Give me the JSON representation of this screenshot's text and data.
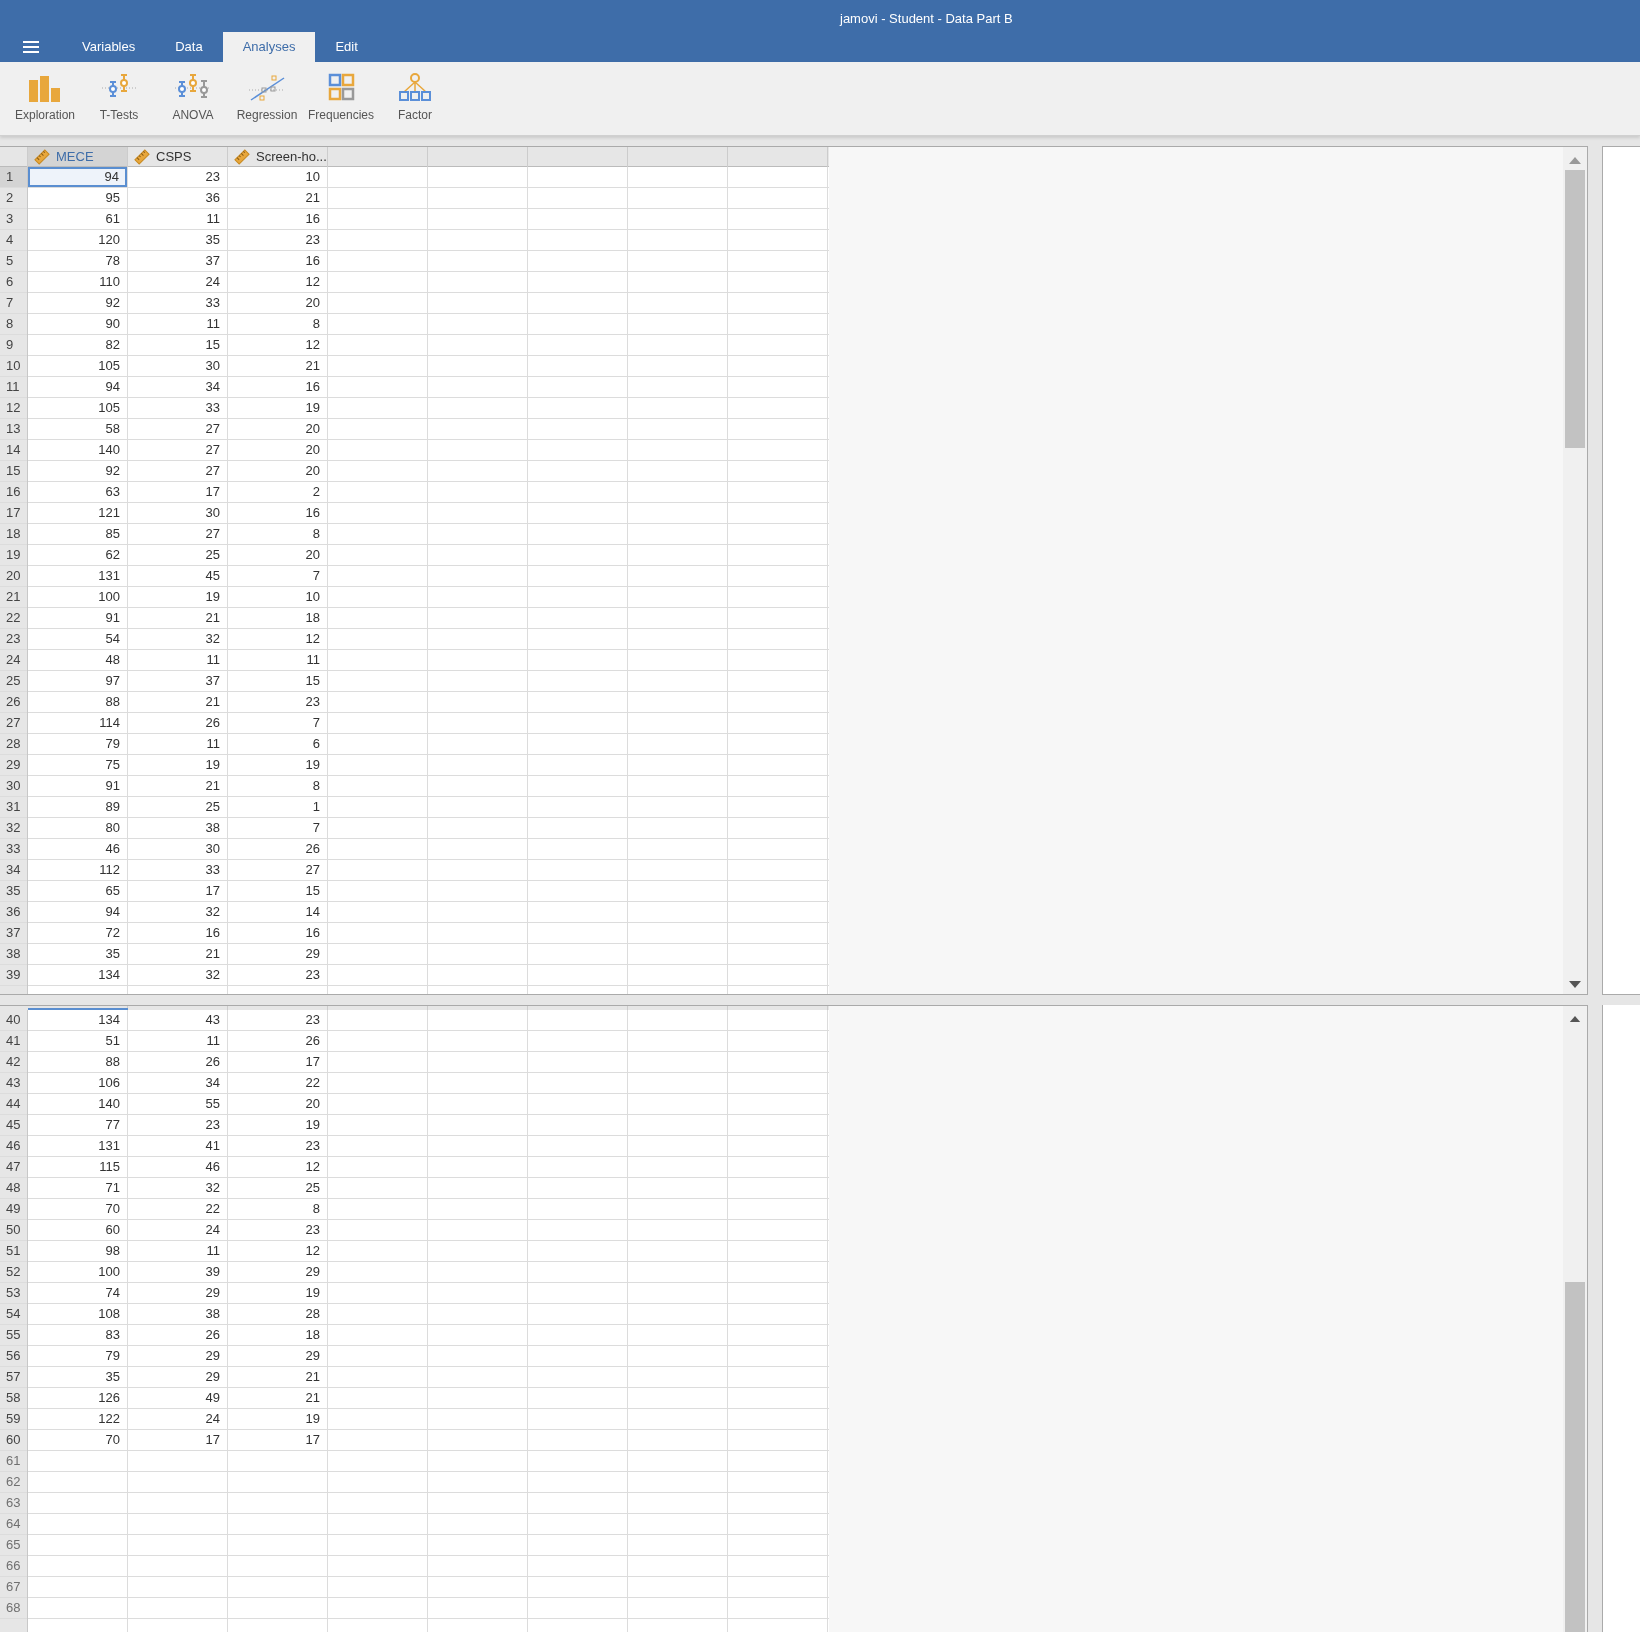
{
  "window": {
    "title": "jamovi - Student - Data Part B"
  },
  "menu_tabs": [
    {
      "label": "Variables",
      "selected": false
    },
    {
      "label": "Data",
      "selected": false
    },
    {
      "label": "Analyses",
      "selected": true
    },
    {
      "label": "Edit",
      "selected": false
    }
  ],
  "toolbar": [
    {
      "kind": "exploration",
      "label": "Exploration"
    },
    {
      "kind": "ttests",
      "label": "T-Tests"
    },
    {
      "kind": "anova",
      "label": "ANOVA"
    },
    {
      "kind": "regression",
      "label": "Regression"
    },
    {
      "kind": "frequencies",
      "label": "Frequencies"
    },
    {
      "kind": "factor",
      "label": "Factor"
    }
  ],
  "panes": [
    {
      "columns": [
        {
          "name": "MECE",
          "selected": true
        },
        {
          "name": "CSPS",
          "selected": false
        },
        {
          "name": "Screen-ho...",
          "selected": false
        }
      ],
      "rows": [
        {
          "number": "1",
          "selected": true,
          "cells": [
            "94",
            "23",
            "10"
          ]
        },
        {
          "number": "2",
          "selected": false,
          "cells": [
            "95",
            "36",
            "21"
          ]
        },
        {
          "number": "3",
          "selected": false,
          "cells": [
            "61",
            "11",
            "16"
          ]
        },
        {
          "number": "4",
          "selected": false,
          "cells": [
            "120",
            "35",
            "23"
          ]
        },
        {
          "number": "5",
          "selected": false,
          "cells": [
            "78",
            "37",
            "16"
          ]
        },
        {
          "number": "6",
          "selected": false,
          "cells": [
            "110",
            "24",
            "12"
          ]
        },
        {
          "number": "7",
          "selected": false,
          "cells": [
            "92",
            "33",
            "20"
          ]
        },
        {
          "number": "8",
          "selected": false,
          "cells": [
            "90",
            "11",
            "8"
          ]
        },
        {
          "number": "9",
          "selected": false,
          "cells": [
            "82",
            "15",
            "12"
          ]
        },
        {
          "number": "10",
          "selected": false,
          "cells": [
            "105",
            "30",
            "21"
          ]
        },
        {
          "number": "11",
          "selected": false,
          "cells": [
            "94",
            "34",
            "16"
          ]
        },
        {
          "number": "12",
          "selected": false,
          "cells": [
            "105",
            "33",
            "19"
          ]
        },
        {
          "number": "13",
          "selected": false,
          "cells": [
            "58",
            "27",
            "20"
          ]
        },
        {
          "number": "14",
          "selected": false,
          "cells": [
            "140",
            "27",
            "20"
          ]
        },
        {
          "number": "15",
          "selected": false,
          "cells": [
            "92",
            "27",
            "20"
          ]
        },
        {
          "number": "16",
          "selected": false,
          "cells": [
            "63",
            "17",
            "2"
          ]
        },
        {
          "number": "17",
          "selected": false,
          "cells": [
            "121",
            "30",
            "16"
          ]
        },
        {
          "number": "18",
          "selected": false,
          "cells": [
            "85",
            "27",
            "8"
          ]
        },
        {
          "number": "19",
          "selected": false,
          "cells": [
            "62",
            "25",
            "20"
          ]
        },
        {
          "number": "20",
          "selected": false,
          "cells": [
            "131",
            "45",
            "7"
          ]
        },
        {
          "number": "21",
          "selected": false,
          "cells": [
            "100",
            "19",
            "10"
          ]
        },
        {
          "number": "22",
          "selected": false,
          "cells": [
            "91",
            "21",
            "18"
          ]
        },
        {
          "number": "23",
          "selected": false,
          "cells": [
            "54",
            "32",
            "12"
          ]
        },
        {
          "number": "24",
          "selected": false,
          "cells": [
            "48",
            "11",
            "11"
          ]
        },
        {
          "number": "25",
          "selected": false,
          "cells": [
            "97",
            "37",
            "15"
          ]
        },
        {
          "number": "26",
          "selected": false,
          "cells": [
            "88",
            "21",
            "23"
          ]
        },
        {
          "number": "27",
          "selected": false,
          "cells": [
            "114",
            "26",
            "7"
          ]
        },
        {
          "number": "28",
          "selected": false,
          "cells": [
            "79",
            "11",
            "6"
          ]
        },
        {
          "number": "29",
          "selected": false,
          "cells": [
            "75",
            "19",
            "19"
          ]
        },
        {
          "number": "30",
          "selected": false,
          "cells": [
            "91",
            "21",
            "8"
          ]
        },
        {
          "number": "31",
          "selected": false,
          "cells": [
            "89",
            "25",
            "1"
          ]
        },
        {
          "number": "32",
          "selected": false,
          "cells": [
            "80",
            "38",
            "7"
          ]
        },
        {
          "number": "33",
          "selected": false,
          "cells": [
            "46",
            "30",
            "26"
          ]
        },
        {
          "number": "34",
          "selected": false,
          "cells": [
            "112",
            "33",
            "27"
          ]
        },
        {
          "number": "35",
          "selected": false,
          "cells": [
            "65",
            "17",
            "15"
          ]
        },
        {
          "number": "36",
          "selected": false,
          "cells": [
            "94",
            "32",
            "14"
          ]
        },
        {
          "number": "37",
          "selected": false,
          "cells": [
            "72",
            "16",
            "16"
          ]
        },
        {
          "number": "38",
          "selected": false,
          "cells": [
            "35",
            "21",
            "29"
          ]
        },
        {
          "number": "39",
          "selected": false,
          "cells": [
            "134",
            "32",
            "23"
          ]
        }
      ]
    },
    {
      "rows": [
        {
          "number": "40",
          "selected": false,
          "cells": [
            "134",
            "43",
            "23"
          ]
        },
        {
          "number": "41",
          "selected": false,
          "cells": [
            "51",
            "11",
            "26"
          ]
        },
        {
          "number": "42",
          "selected": false,
          "cells": [
            "88",
            "26",
            "17"
          ]
        },
        {
          "number": "43",
          "selected": false,
          "cells": [
            "106",
            "34",
            "22"
          ]
        },
        {
          "number": "44",
          "selected": false,
          "cells": [
            "140",
            "55",
            "20"
          ]
        },
        {
          "number": "45",
          "selected": false,
          "cells": [
            "77",
            "23",
            "19"
          ]
        },
        {
          "number": "46",
          "selected": false,
          "cells": [
            "131",
            "41",
            "23"
          ]
        },
        {
          "number": "47",
          "selected": false,
          "cells": [
            "115",
            "46",
            "12"
          ]
        },
        {
          "number": "48",
          "selected": false,
          "cells": [
            "71",
            "32",
            "25"
          ]
        },
        {
          "number": "49",
          "selected": false,
          "cells": [
            "70",
            "22",
            "8"
          ]
        },
        {
          "number": "50",
          "selected": false,
          "cells": [
            "60",
            "24",
            "23"
          ]
        },
        {
          "number": "51",
          "selected": false,
          "cells": [
            "98",
            "11",
            "12"
          ]
        },
        {
          "number": "52",
          "selected": false,
          "cells": [
            "100",
            "39",
            "29"
          ]
        },
        {
          "number": "53",
          "selected": false,
          "cells": [
            "74",
            "29",
            "19"
          ]
        },
        {
          "number": "54",
          "selected": false,
          "cells": [
            "108",
            "38",
            "28"
          ]
        },
        {
          "number": "55",
          "selected": false,
          "cells": [
            "83",
            "26",
            "18"
          ]
        },
        {
          "number": "56",
          "selected": false,
          "cells": [
            "79",
            "29",
            "29"
          ]
        },
        {
          "number": "57",
          "selected": false,
          "cells": [
            "35",
            "29",
            "21"
          ]
        },
        {
          "number": "58",
          "selected": false,
          "cells": [
            "126",
            "49",
            "21"
          ]
        },
        {
          "number": "59",
          "selected": false,
          "cells": [
            "122",
            "24",
            "19"
          ]
        },
        {
          "number": "60",
          "selected": false,
          "cells": [
            "70",
            "17",
            "17"
          ]
        },
        {
          "number": "61",
          "selected": false,
          "cells": []
        },
        {
          "number": "62",
          "selected": false,
          "cells": []
        },
        {
          "number": "63",
          "selected": false,
          "cells": []
        },
        {
          "number": "64",
          "selected": false,
          "cells": []
        },
        {
          "number": "65",
          "selected": false,
          "cells": []
        },
        {
          "number": "66",
          "selected": false,
          "cells": []
        },
        {
          "number": "67",
          "selected": false,
          "cells": []
        },
        {
          "number": "68",
          "selected": false,
          "cells": []
        }
      ]
    }
  ]
}
